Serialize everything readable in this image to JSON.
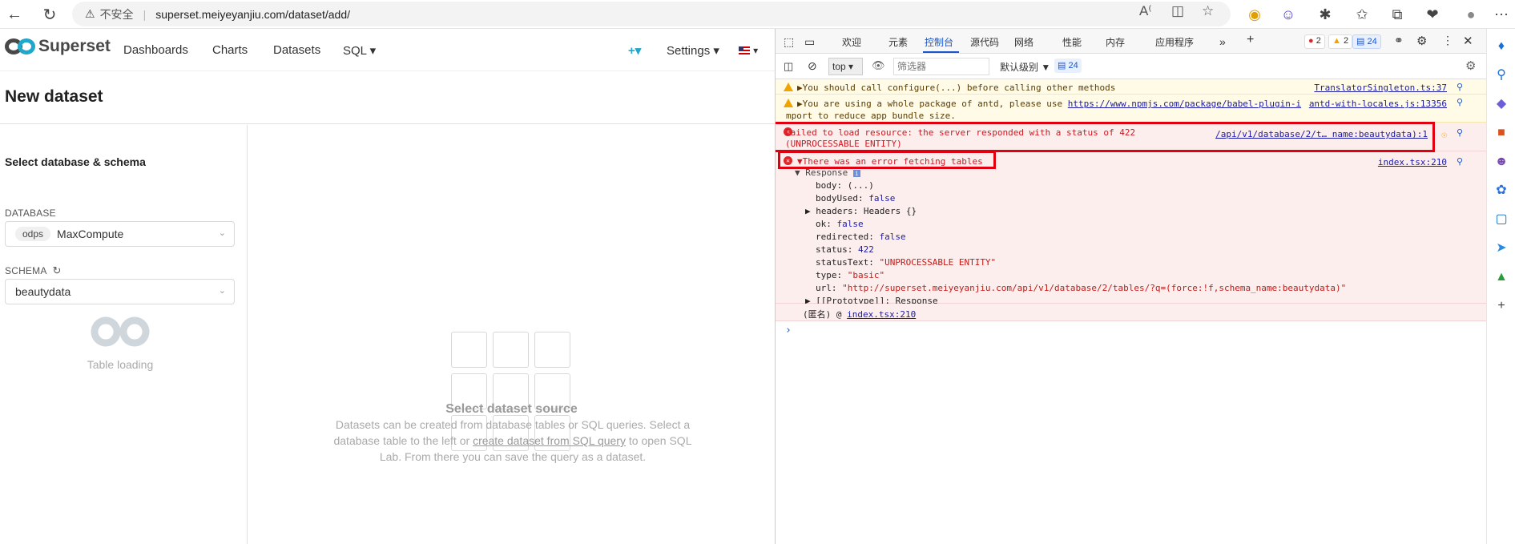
{
  "browser": {
    "insecure_label": "不安全",
    "url": "superset.meiyeyanjiu.com/dataset/add/"
  },
  "nav": {
    "brand": "Superset",
    "items": [
      "Dashboards",
      "Charts",
      "Datasets",
      "SQL ▾"
    ],
    "plus": "+▾",
    "settings": "Settings ▾",
    "lang": "▾"
  },
  "page": {
    "title": "New dataset"
  },
  "left": {
    "section_title": "Select database & schema",
    "database_label": "DATABASE",
    "database_tag": "odps",
    "database_value": "MaxCompute",
    "schema_label": "SCHEMA",
    "schema_value": "beautydata",
    "loading_text": "Table loading"
  },
  "right": {
    "empty_title": "Select dataset source",
    "desc_part1": "Datasets can be created from database tables or SQL queries. Select a database table to the left or ",
    "desc_link": "create dataset from SQL query",
    "desc_part2": " to open SQL Lab. From there you can save the query as a dataset."
  },
  "devtools": {
    "tabs": [
      "欢迎",
      "元素",
      "控制台",
      "源代码",
      "网络",
      "性能",
      "内存",
      "应用程序"
    ],
    "active_tab": "控制台",
    "errors_count": "2",
    "warnings_count": "2",
    "issues_count": "24",
    "context": "top",
    "filter_placeholder": "筛选器",
    "level": "默认级别",
    "toolbar_issues": "24",
    "messages": [
      {
        "level": "warn",
        "text": "▶You should call configure(...) before calling other methods",
        "source": "TranslatorSingleton.ts:37"
      },
      {
        "level": "warn",
        "text_a": "▶You are using a whole package of antd, please use ",
        "link": "https://www.npmjs.com/package/babel-plugin-i",
        "text_b": "mport to reduce app bundle size.",
        "source": "antd-with-locales.js:13356"
      },
      {
        "level": "error",
        "text_a": "Failed to load resource: the server responded with a status of 422",
        "text_b": "(UNPROCESSABLE ENTITY)",
        "source": "/api/v1/database/2/t… name:beautydata):1"
      },
      {
        "level": "error",
        "text": "▼There was an error fetching tables",
        "source": "index.tsx:210"
      }
    ],
    "response": {
      "header": "▼ Response",
      "props": [
        {
          "k": "body",
          "v": "(...)",
          "t": "plain"
        },
        {
          "k": "bodyUsed",
          "v": "false",
          "t": "bool"
        },
        {
          "k": "▶ headers",
          "v": "Headers {}",
          "t": "plain"
        },
        {
          "k": "ok",
          "v": "false",
          "t": "bool"
        },
        {
          "k": "redirected",
          "v": "false",
          "t": "bool"
        },
        {
          "k": "status",
          "v": "422",
          "t": "num"
        },
        {
          "k": "statusText",
          "v": "\"UNPROCESSABLE ENTITY\"",
          "t": "str"
        },
        {
          "k": "type",
          "v": "\"basic\"",
          "t": "str"
        },
        {
          "k": "url",
          "v": "\"http://superset.meiyeyanjiu.com/api/v1/database/2/tables/?q=(force:!f,schema_name:beautydata)\"",
          "t": "str"
        },
        {
          "k": "▶ [[Prototype]]",
          "v": "Response",
          "t": "plain"
        }
      ],
      "anon": "(匿名) @ ",
      "anon_link": "index.tsx:210"
    },
    "prompt": "›"
  },
  "colors": {
    "brand_teal": "#20a7c9",
    "error_red": "#e1000f",
    "active_tab_blue": "#1a55c9"
  }
}
